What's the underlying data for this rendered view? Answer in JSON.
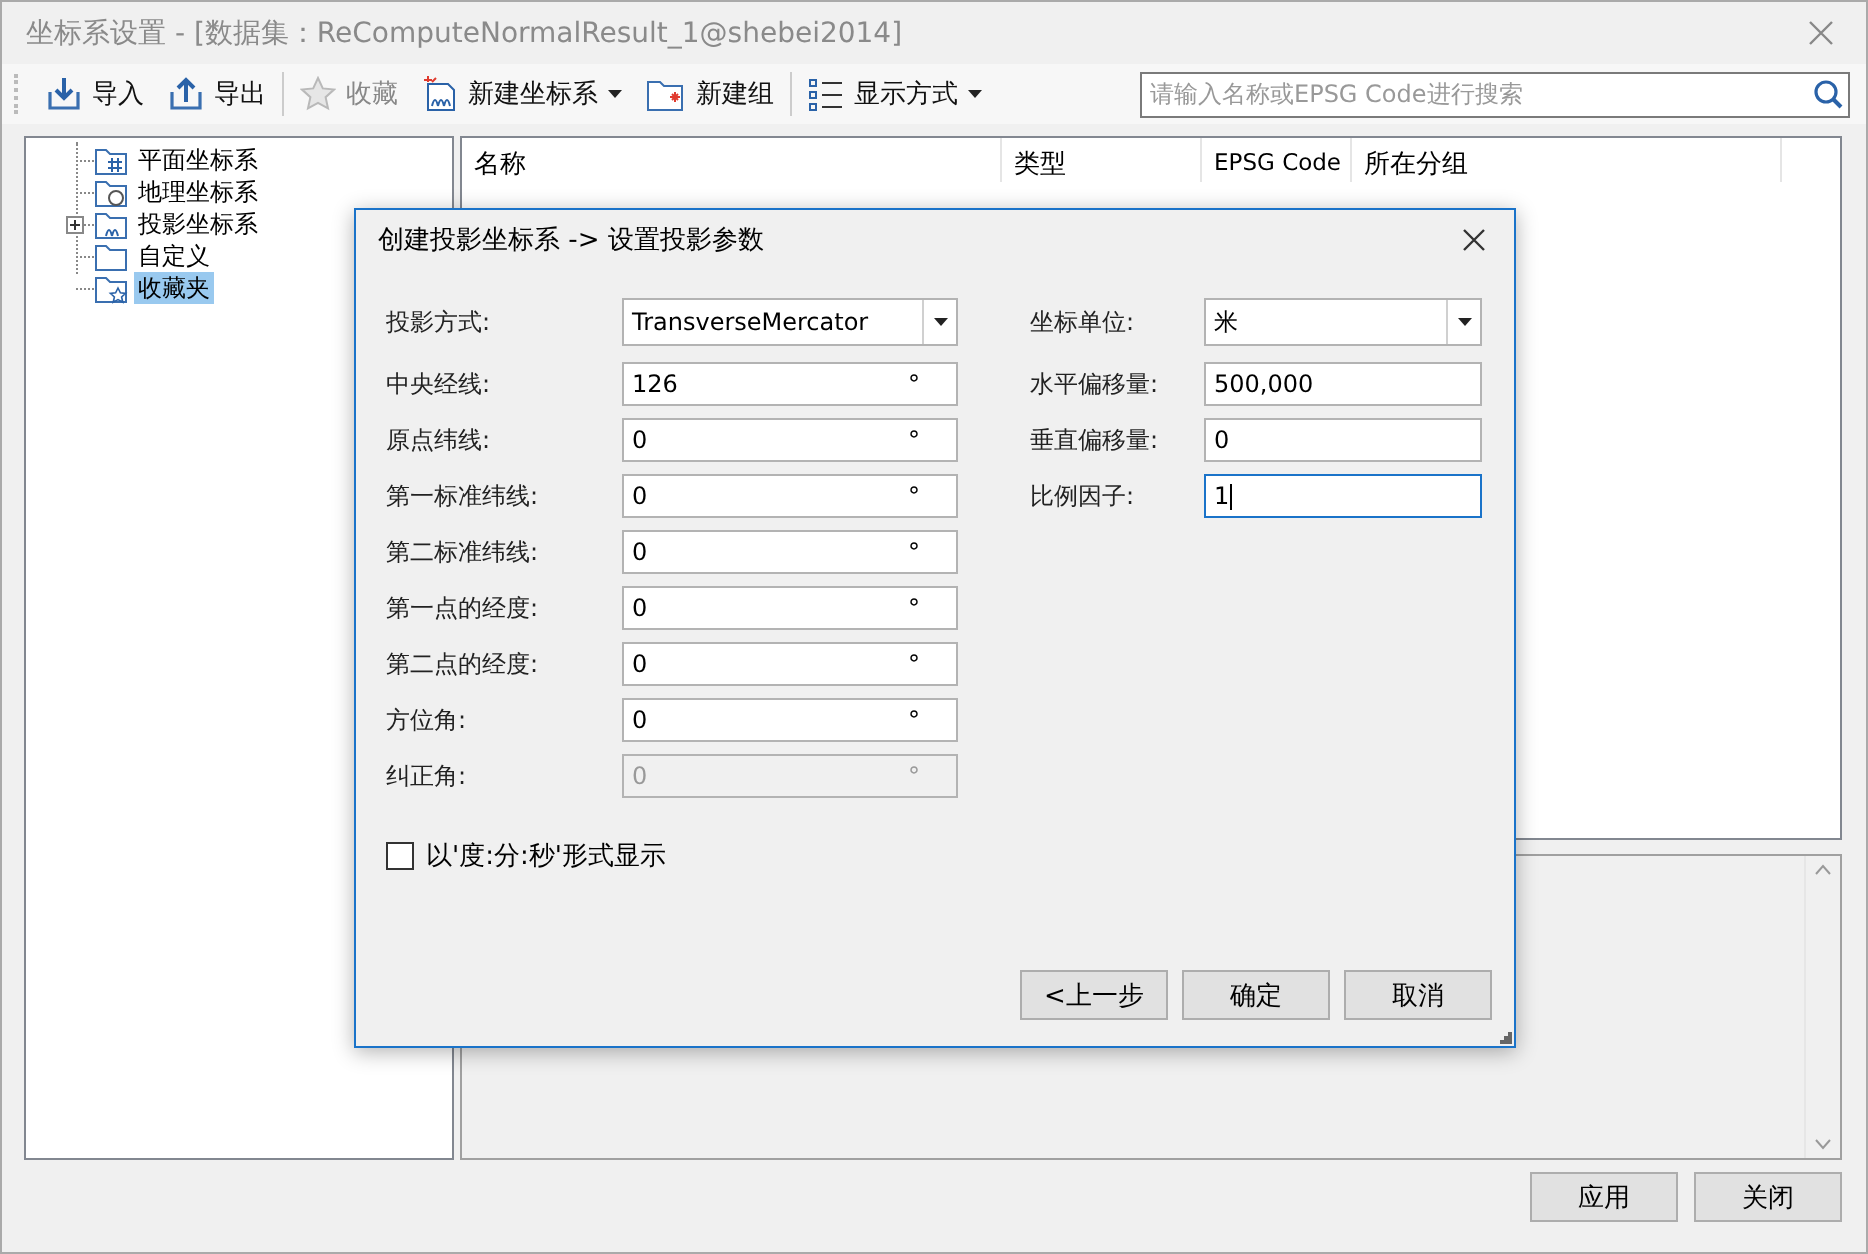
{
  "window": {
    "title": "坐标系设置 - [数据集：ReComputeNormalResult_1@shebei2014]"
  },
  "toolbar": {
    "items": [
      {
        "label": "导入",
        "disabled": false,
        "dropdown": false
      },
      {
        "label": "导出",
        "disabled": false,
        "dropdown": false
      },
      {
        "label": "收藏",
        "disabled": true,
        "dropdown": false
      },
      {
        "label": "新建坐标系",
        "disabled": false,
        "dropdown": true
      },
      {
        "label": "新建组",
        "disabled": false,
        "dropdown": false
      },
      {
        "label": "显示方式",
        "disabled": false,
        "dropdown": true
      }
    ]
  },
  "search": {
    "placeholder": "请输入名称或EPSG Code进行搜索"
  },
  "tree": {
    "items": [
      {
        "label": "平面坐标系",
        "expandable": false,
        "selected": false
      },
      {
        "label": "地理坐标系",
        "expandable": false,
        "selected": false
      },
      {
        "label": "投影坐标系",
        "expandable": true,
        "selected": false
      },
      {
        "label": "自定义",
        "expandable": false,
        "selected": false
      },
      {
        "label": "收藏夹",
        "expandable": false,
        "selected": true
      }
    ]
  },
  "list": {
    "columns": [
      "名称",
      "类型",
      "EPSG Code",
      "所在分组"
    ]
  },
  "dialog": {
    "title": "创建投影坐标系 -> 设置投影参数",
    "left_fields": [
      {
        "label": "投影方式:",
        "kind": "combo",
        "value": "TransverseMercator",
        "disabled": false
      },
      {
        "label": "中央经线:",
        "kind": "angle",
        "value": "126",
        "unit": "°",
        "disabled": false
      },
      {
        "label": "原点纬线:",
        "kind": "angle",
        "value": "0",
        "unit": "°",
        "disabled": false
      },
      {
        "label": "第一标准纬线:",
        "kind": "angle",
        "value": "0",
        "unit": "°",
        "disabled": false
      },
      {
        "label": "第二标准纬线:",
        "kind": "angle",
        "value": "0",
        "unit": "°",
        "disabled": false
      },
      {
        "label": "第一点的经度:",
        "kind": "angle",
        "value": "0",
        "unit": "°",
        "disabled": false
      },
      {
        "label": "第二点的经度:",
        "kind": "angle",
        "value": "0",
        "unit": "°",
        "disabled": false
      },
      {
        "label": "方位角:",
        "kind": "angle",
        "value": "0",
        "unit": "°",
        "disabled": false
      },
      {
        "label": "纠正角:",
        "kind": "angle",
        "value": "0",
        "unit": "°",
        "disabled": true
      }
    ],
    "right_fields": [
      {
        "label": "坐标单位:",
        "kind": "combo",
        "value": "米",
        "focused": false
      },
      {
        "label": "水平偏移量:",
        "kind": "text",
        "value": "500,000",
        "focused": false
      },
      {
        "label": "垂直偏移量:",
        "kind": "text",
        "value": "0",
        "focused": false
      },
      {
        "label": "比例因子:",
        "kind": "text",
        "value": "1",
        "focused": true
      }
    ],
    "checkbox": {
      "label": "以'度:分:秒'形式显示",
      "checked": false
    },
    "buttons": [
      "<上一步",
      "确定",
      "取消"
    ]
  },
  "bottom_buttons": [
    "应用",
    "关闭"
  ]
}
